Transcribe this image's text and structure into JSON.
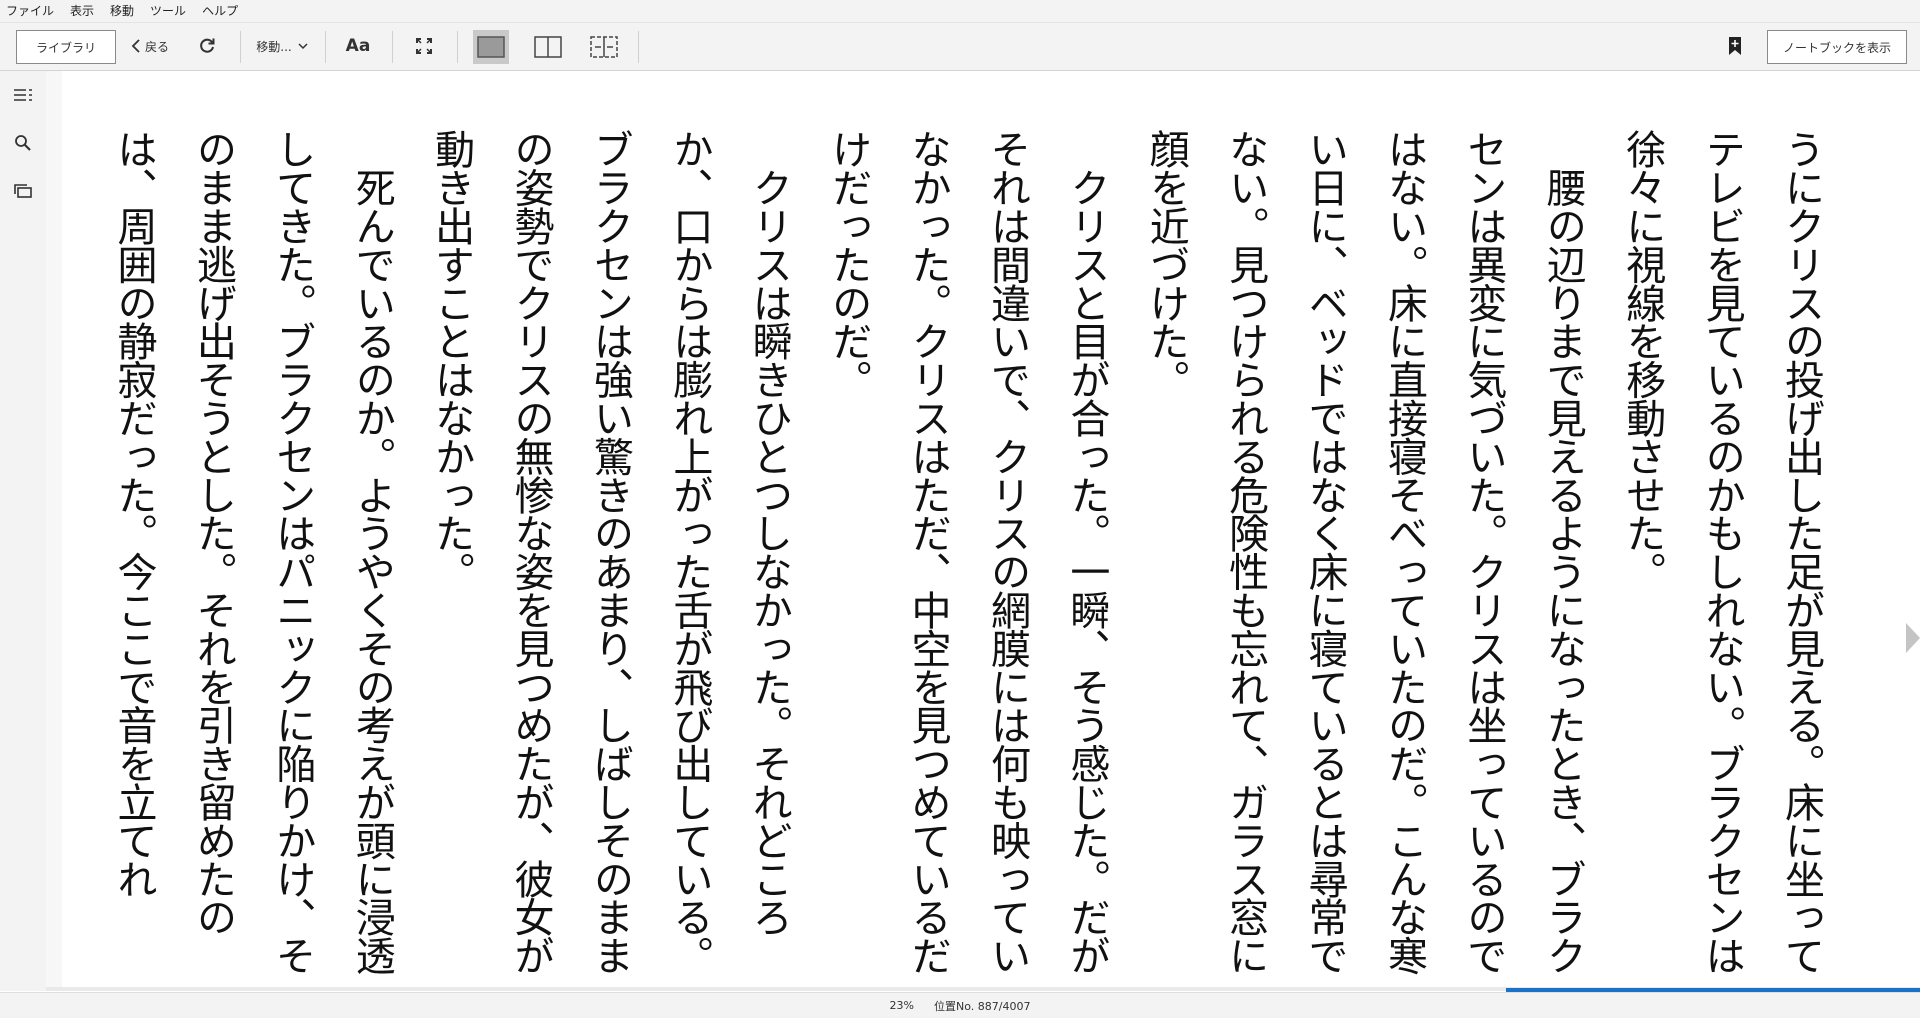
{
  "menu": [
    "ファイル",
    "表示",
    "移動",
    "ツール",
    "ヘルプ"
  ],
  "toolbar": {
    "library": "ライブラリ",
    "back": "戻る",
    "goto": "移動...",
    "font_button": "Aa",
    "show_notebook": "ノートブックを表示"
  },
  "icons": {
    "back": "chevron-left-icon",
    "sync": "sync-icon",
    "goto_dropdown": "chevron-down-icon",
    "fullscreen": "fullscreen-icon",
    "single_column": "single-column-icon",
    "two_columns": "two-columns-icon",
    "multi_page": "multi-page-icon",
    "bookmark": "bookmark-add-icon",
    "toc": "table-of-contents-icon",
    "search": "search-icon",
    "flashcards": "flashcards-icon",
    "next_page": "next-page-icon"
  },
  "content": {
    "paragraphs": [
      "うにクリスの投げ出した足が見える。床に坐ってテレビを見ているのかもしれない。ブラクセンは徐々に視線を移動させた。",
      "　腰の辺りまで見えるようになったとき、ブラクセンは異変に気づいた。クリスは坐っているのではない。床に直接寝そべっていたのだ。こんな寒い日に、ベッドではなく床に寝ているとは尋常でない。見つけられる危険性も忘れて、ガラス窓に顔を近づけた。",
      "　クリスと目が合った。一瞬、そう感じた。だがそれは間違いで、クリスの網膜には何も映っていなかった。クリスはただ、中空を見つめているだけだったのだ。",
      "　クリスは瞬きひとつしなかった。それどころか、口からは膨れ上がった舌が飛び出している。ブラクセンは強い驚きのあまり、しばしそのままの姿勢でクリスの無惨な姿を見つめたが、彼女が動き出すことはなかった。",
      "　死んでいるのか。ようやくその考えが頭に浸透してきた。ブラクセンはパニックに陥りかけ、そのまま逃げ出そうとした。それを引き留めたのは、周囲の静寂だった。今ここで音を立てれ"
    ]
  },
  "status": {
    "percent": "23%",
    "location": "位置No. 887/4007",
    "progress_fraction": 0.23
  },
  "colors": {
    "progress": "#1a73c9",
    "chrome": "#f3f3f3"
  }
}
